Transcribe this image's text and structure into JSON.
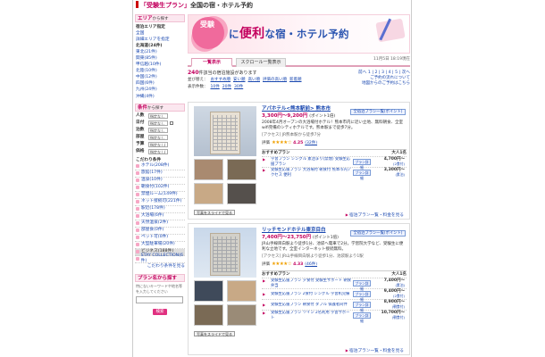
{
  "header": {
    "title_pink": "「受験生プラン」",
    "title_rest": "全国の宿・ホテル予約"
  },
  "sidebar": {
    "area_heading": "エリア",
    "area_sub": "から探す",
    "area_links": [
      "宿泊エリア指定",
      "全国",
      "詳細エリアを指定",
      "北海道(24件)",
      "東北(21件)",
      "関東(85件)",
      "甲信越(10件)",
      "北陸(10件)",
      "中国(12件)",
      "四国(6件)",
      "九州(24件)",
      "沖縄(4件)"
    ],
    "conditions_heading": "条件",
    "conditions_sub": "から探す",
    "cond_rows": [
      {
        "label": "人数",
        "value": "指定なし"
      },
      {
        "label": "日付",
        "value": "指定なし"
      },
      {
        "label": "泊数",
        "value": "指定なし"
      },
      {
        "label": "部屋",
        "value": "指定なし"
      },
      {
        "label": "予算",
        "value": "指定なし(上限)"
      },
      {
        "label": "価格",
        "value": "指定なし(上限)"
      }
    ],
    "category_heading": "こだわり条件",
    "categories": [
      "ホテル(208件)",
      "旅館(17件)",
      "温泉(10件)",
      "朝食付(102件)",
      "禁煙ルーム(149件)",
      "ネット接続可(221件)",
      "駅近(178件)",
      "大浴場(6件)",
      "天然温泉(2件)",
      "部屋食(0件)",
      "ペット可(0件)",
      "大型駐車場(20件)",
      "ビジネス(188件)",
      "STAY COLLECTION(6件)"
    ],
    "more_categories": "こだわり条件を見る",
    "plan_search_heading": "プラン名から探す",
    "keyword_hint": "特にないキーワードや地名等を入力してください",
    "keyword_placeholder": "",
    "search_button": "検索"
  },
  "banner": {
    "badge": "受験",
    "tagline_a": "に",
    "tagline_b": "便利",
    "tagline_c": "な宿・ホテル予約"
  },
  "tabs": {
    "list": "一覧表示",
    "scroll": "スクロール一覧表示"
  },
  "updated": "11月5日 18:19現在",
  "results": {
    "count": "240",
    "count_suffix": "件該当の宿泊施設があります",
    "pager": "前へ 1 | 2 | 3 | 4 | 5 | 次へ",
    "sort_label": "並び替え：",
    "sort_links": [
      "おすすめ順",
      "安い順",
      "高い順",
      "評価の高い順",
      "新着順"
    ],
    "display_label": "表示件数：",
    "display_counts": [
      "10件",
      "20件",
      "30件"
    ],
    "right_link_1": "ご予約の流れについて",
    "right_link_2": "地図からのご予約はこちら"
  },
  "hotels": [
    {
      "name": "アパホテル<熊本駅前> 熊本市",
      "price": "3,300円〜9,200円",
      "points": "(ポイント1倍)",
      "desc": "2008年4月オープンの大浴場付ホテル！熊本市内に近い立地、無料朝食、全室wifi完備のシティホテルです。熊本駅まで徒歩7分。",
      "access": "[アクセス] JR熊本駅から徒歩7分",
      "rating": "4.25",
      "reviews": "(32件)",
      "plan_header": "おすすめプラン",
      "plan_header_right": "大人1名",
      "plans": [
        {
          "title": "学習プラン シングル 素泊まり(禁煙) 受験生応援プラン",
          "button": "プラン詳細",
          "price": "4,700円〜",
          "sub": "(2食付)"
        },
        {
          "title": "受験生応援プラン 大浴場付 朝食付 熊本市内アクセス 便利",
          "button": "プラン詳細",
          "price": "3,300円〜",
          "sub": "(素泊)"
        }
      ],
      "plan_list_btn": "全宿泊プラン一覧(ポイント)",
      "gallery_btn": "写真をスライドで見る",
      "more": "宿泊プラン一覧・料金を見る"
    },
    {
      "name": "リッチモンドホテル東京目白",
      "price": "7,400円〜23,750円",
      "points": "(ポイント1倍)",
      "desc": "JR山手線目白駅より徒歩1分、池袋へ電車で2分。学習院大学など、受験生に便利な立地です。全室インターネット接続無料。",
      "access": "[アクセス] JR山手線目白駅より徒歩1分、池袋駅より1駅",
      "rating": "4.33",
      "reviews": "(46件)",
      "plan_header": "おすすめプラン",
      "plan_header_right": "大人1名",
      "plans": [
        {
          "title": "受験生応援プラン 夕食付 受験生サポート 朝食弁当",
          "button": "プラン詳細",
          "price": "7,400円〜",
          "sub": "(素泊)"
        },
        {
          "title": "受験生応援プラン 2食付 シングル 学習机完備",
          "button": "プラン詳細",
          "price": "9,400円〜",
          "sub": "(2食付)"
        },
        {
          "title": "受験生応援プラン 朝食付 ダブル 保護者同伴",
          "button": "プラン詳細",
          "price": "8,900円〜",
          "sub": "(朝食付)"
        },
        {
          "title": "受験生応援プラン ツイン 2名利用 学習サポート",
          "button": "プラン詳細",
          "price": "10,700円〜",
          "sub": "(朝食付)"
        }
      ],
      "plan_list_btn": "全宿泊プラン一覧(ポイント)",
      "gallery_btn": "写真をスライドで見る",
      "more": "宿泊プラン一覧・料金を見る"
    }
  ],
  "colors": {
    "accent": "#c3005e",
    "link": "#1a48b0",
    "banner_bg": "#fde0e8"
  },
  "icons": {
    "star": "★"
  }
}
